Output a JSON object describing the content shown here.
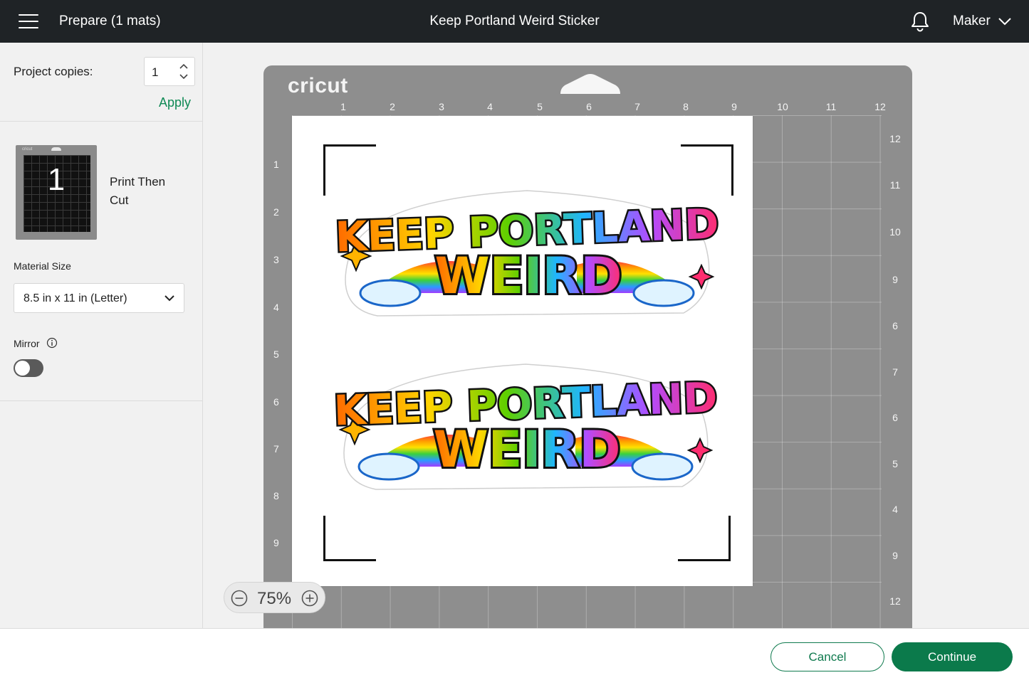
{
  "header": {
    "prepare_title": "Prepare (1 mats)",
    "project_title": "Keep Portland Weird Sticker",
    "machine_label": "Maker"
  },
  "sidebar": {
    "copies_label": "Project copies:",
    "copies_value": "1",
    "apply_label": "Apply",
    "mat_number": "1",
    "mat_mode": "Print Then Cut",
    "mat_thumb_brand": "cricut",
    "material_size_label": "Material Size",
    "material_size_value": "8.5 in x 11 in (Letter)",
    "mirror_label": "Mirror",
    "mirror_on": false
  },
  "mat": {
    "brand": "cricut",
    "ruler_top": [
      "1",
      "2",
      "3",
      "4",
      "5",
      "6",
      "7",
      "8",
      "9",
      "10",
      "11",
      "12"
    ],
    "ruler_left": [
      "1",
      "2",
      "3",
      "4",
      "5",
      "6",
      "7",
      "8",
      "9"
    ],
    "ruler_right": [
      "12",
      "11",
      "10",
      "9",
      "6",
      "7",
      "6",
      "5",
      "4",
      "9",
      "12"
    ]
  },
  "stickers": [
    {
      "line1": "KEEP PORTLAND",
      "line2": "WEIRD"
    },
    {
      "line1": "KEEP PORTLAND",
      "line2": "WEIRD"
    }
  ],
  "zoom": {
    "level": "75%"
  },
  "footer": {
    "cancel_label": "Cancel",
    "continue_label": "Continue"
  },
  "colors": {
    "accent": "#0b7a4b",
    "topbar": "#1f2326",
    "mat": "#8e8e8e"
  }
}
